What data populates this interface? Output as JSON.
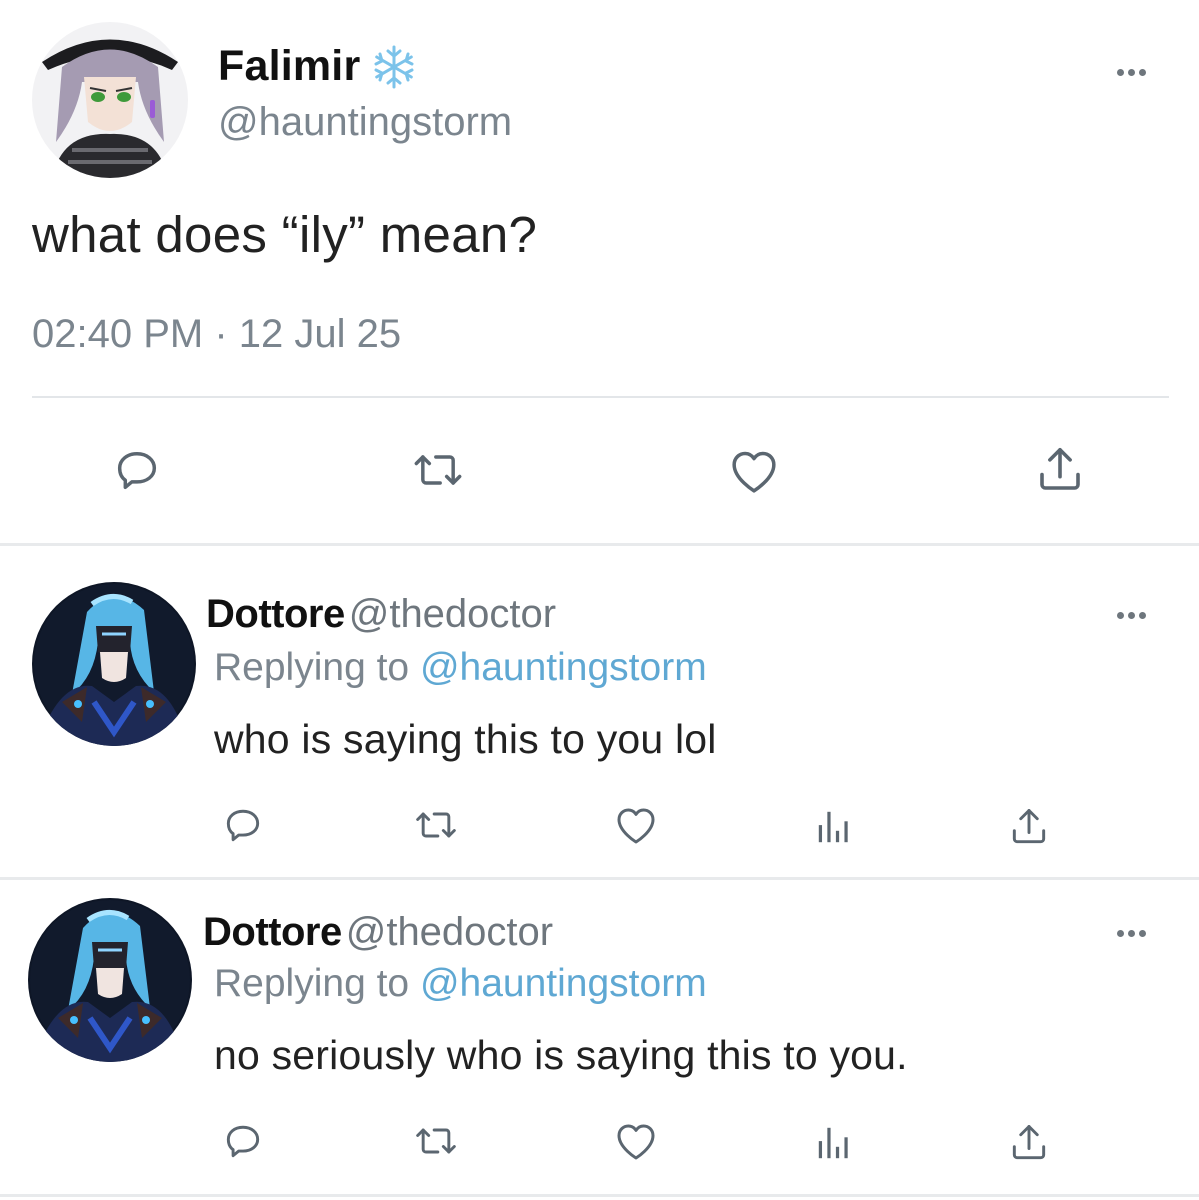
{
  "main_tweet": {
    "display_name": "Falimir",
    "name_emoji_icon": "snowflake-icon",
    "handle": "@hauntingstorm",
    "text": "what does “ily” mean?",
    "timestamp": "02:40 PM · 12 Jul 25",
    "actions": [
      "reply-icon",
      "retweet-icon",
      "like-icon",
      "share-icon"
    ]
  },
  "replies": [
    {
      "display_name": "Dottore",
      "handle": "@thedoctor",
      "replying_prefix": "Replying to ",
      "replying_to": "@hauntingstorm",
      "text": "who is saying this to you lol",
      "actions": [
        "reply-icon",
        "retweet-icon",
        "like-icon",
        "analytics-icon",
        "share-icon"
      ]
    },
    {
      "display_name": "Dottore",
      "handle": "@thedoctor",
      "replying_prefix": "Replying to ",
      "replying_to": "@hauntingstorm",
      "text": "no seriously who is saying this to you.",
      "actions": [
        "reply-icon",
        "retweet-icon",
        "like-icon",
        "analytics-icon",
        "share-icon"
      ]
    }
  ],
  "colors": {
    "mention": "#5fa8d3",
    "secondary_text": "#7b858e",
    "icon": "#5b6670"
  }
}
